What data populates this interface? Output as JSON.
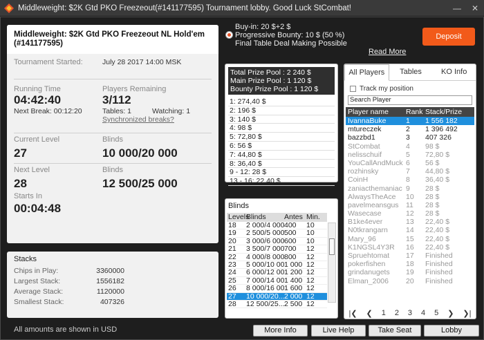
{
  "window": {
    "title": "Middleweight: $2K Gtd PKO Freezeout(#141177595) Tournament lobby. Good Luck StCombat!"
  },
  "info": {
    "name_line1": "Middleweight: $2K Gtd PKO Freezeout NL Hold'em",
    "name_line2": "(#141177595)",
    "started_label": "Tournament Started:",
    "started_value": "July 28 2017  14:00 MSK",
    "running_label": "Running Time",
    "running_value": "04:42:40",
    "next_break": "Next Break: 00:12:20",
    "remaining_label": "Players Remaining",
    "remaining_value": "3/112",
    "tables": "Tables: 1",
    "watching": "Watching: 1",
    "sync_breaks": "Synchronized breaks?",
    "current_level_label": "Current Level",
    "current_level_value": "27",
    "blinds_label": "Blinds",
    "current_blinds": "10 000/20 000",
    "next_level_label": "Next Level",
    "next_level_value": "28",
    "next_blinds": "12 500/25 000",
    "starts_in_label": "Starts In",
    "starts_in_value": "00:04:48"
  },
  "stacks": {
    "title": "Stacks",
    "rows": [
      {
        "label": "Chips in Play:",
        "value": "3360000"
      },
      {
        "label": "Largest Stack:",
        "value": "1556182"
      },
      {
        "label": "Average Stack:",
        "value": "1120000"
      },
      {
        "label": "Smallest Stack:",
        "value": "407326"
      }
    ]
  },
  "footnote": "All amounts are shown in USD",
  "buyin": {
    "line1": "Buy-in: 20 $+2 $",
    "line2": "Progressive Bounty: 10 $ (50 %)",
    "line3": "Final Table Deal Making Possible",
    "read_more": "Read More",
    "deposit": "Deposit"
  },
  "prize": {
    "total": "Total Prize Pool : 2 240 $",
    "main": "Main Prize Pool : 1 120 $",
    "bounty": "Bounty Prize Pool : 1 120 $",
    "places": [
      "1: 274,40 $",
      "2: 196 $",
      "3: 140 $",
      "4: 98 $",
      "5: 72,80 $",
      "6: 56 $",
      "7: 44,80 $",
      "8: 36,40 $",
      "9 - 12: 28 $",
      "13 - 16: 22,40 $"
    ]
  },
  "blinds": {
    "title": "Blinds",
    "headers": [
      "Levels",
      "Blinds",
      "Antes",
      "Min."
    ],
    "rows": [
      [
        "18",
        "2 000/4 000",
        "400",
        "10"
      ],
      [
        "19",
        "2 500/5 000",
        "500",
        "10"
      ],
      [
        "20",
        "3 000/6 000",
        "600",
        "10"
      ],
      [
        "21",
        "3 500/7 000",
        "700",
        "12"
      ],
      [
        "22",
        "4 000/8 000",
        "800",
        "12"
      ],
      [
        "23",
        "5 000/10 000",
        "1 000",
        "12"
      ],
      [
        "24",
        "6 000/12 000",
        "1 200",
        "12"
      ],
      [
        "25",
        "7 000/14 000",
        "1 400",
        "12"
      ],
      [
        "26",
        "8 000/16 000",
        "1 600",
        "12"
      ],
      [
        "27",
        "10 000/20...",
        "2 000",
        "12"
      ],
      [
        "28",
        "12 500/25...",
        "2 500",
        "12"
      ]
    ],
    "selected_row": 9
  },
  "players": {
    "tabs": [
      "All Players",
      "Tables",
      "KO Info"
    ],
    "track": "Track my position",
    "search_placeholder": "Search Player",
    "headers": [
      "Player name",
      "Rank",
      "Stack/Prize"
    ],
    "rows": [
      [
        "IvannaBuke",
        "1",
        "1 556 182"
      ],
      [
        "mtureczek",
        "2",
        "1 396 492"
      ],
      [
        "bazzbd1",
        "3",
        "407 326"
      ],
      [
        "StCombat",
        "4",
        "98 $"
      ],
      [
        "nelisschuif",
        "5",
        "72,80 $"
      ],
      [
        "YouCallAndMuck",
        "6",
        "56 $"
      ],
      [
        "rozhinsky",
        "7",
        "44,80 $"
      ],
      [
        "CoinH",
        "8",
        "36,40 $"
      ],
      [
        "zaniacthemaniac",
        "9",
        "28 $"
      ],
      [
        "AlwaysTheAce",
        "10",
        "28 $"
      ],
      [
        "pavelmeansgus",
        "11",
        "28 $"
      ],
      [
        "Wasecase",
        "12",
        "28 $"
      ],
      [
        "B1ke4ever",
        "13",
        "22,40 $"
      ],
      [
        "N0tkrangarn",
        "14",
        "22,40 $"
      ],
      [
        "Mary_96",
        "15",
        "22,40 $"
      ],
      [
        "K1NGSL4Y3R",
        "16",
        "22,40 $"
      ],
      [
        "Spruehtomat",
        "17",
        "Finished"
      ],
      [
        "pokerfishen",
        "18",
        "Finished"
      ],
      [
        "grindanugets",
        "19",
        "Finished"
      ],
      [
        "Elman_2006",
        "20",
        "Finished"
      ]
    ],
    "pages": [
      "1",
      "2",
      "3",
      "4",
      "5"
    ]
  },
  "buttons": {
    "more_info": "More Info",
    "live_help": "Live Help",
    "take_seat": "Take Seat",
    "lobby": "Lobby"
  }
}
